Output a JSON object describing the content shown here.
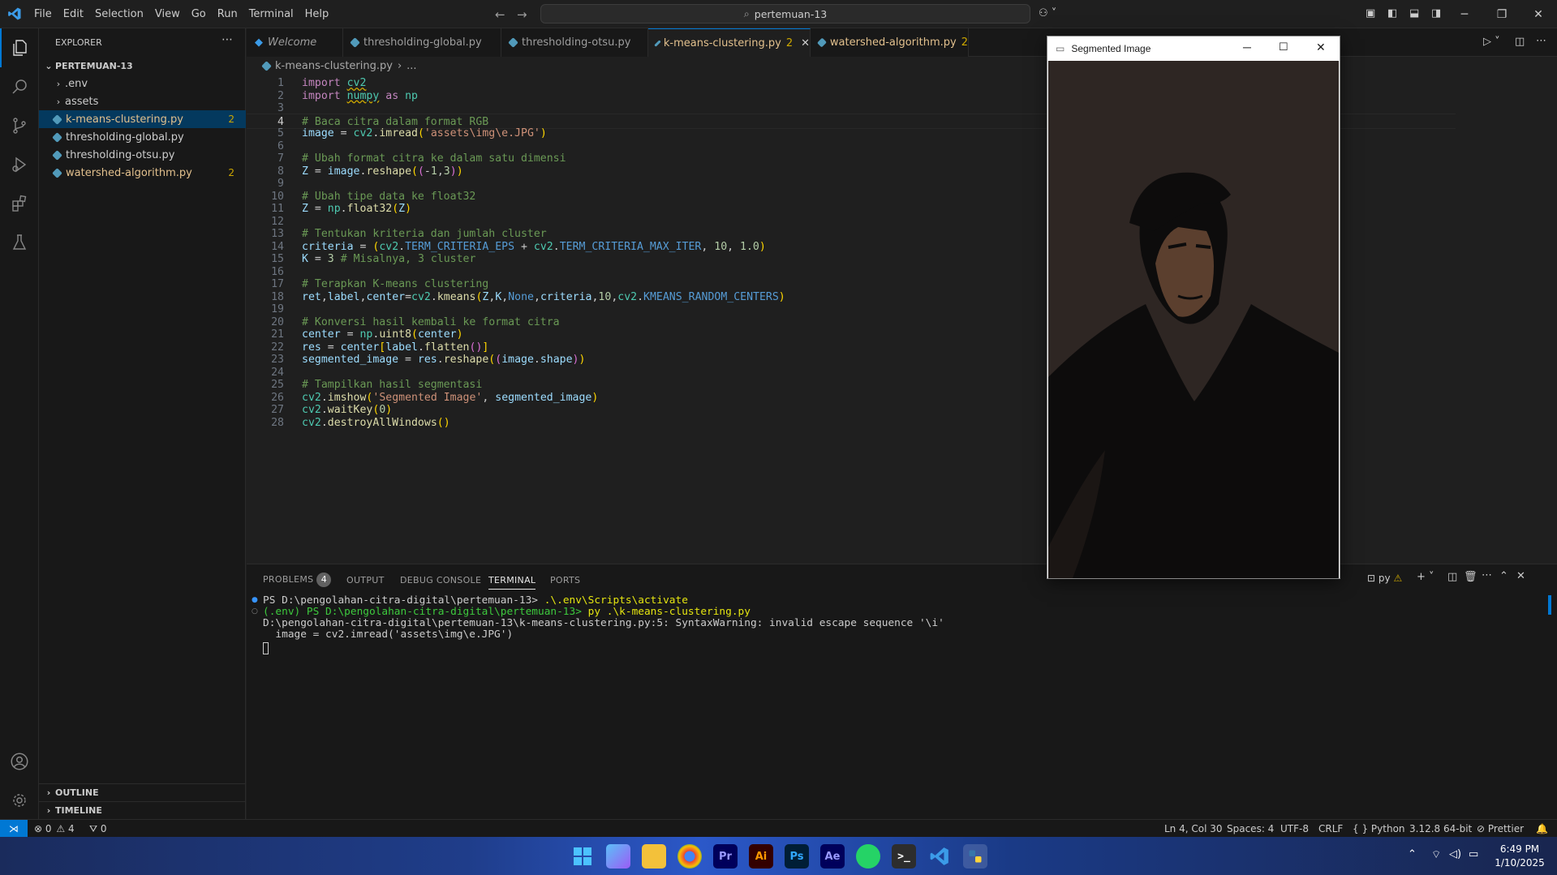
{
  "menu": [
    "File",
    "Edit",
    "Selection",
    "View",
    "Go",
    "Run",
    "Terminal",
    "Help"
  ],
  "search": {
    "text": "pertemuan-13"
  },
  "sidebar": {
    "title": "EXPLORER",
    "folder": "PERTEMUAN-13",
    "items": [
      {
        "label": ".env",
        "type": "folder"
      },
      {
        "label": "assets",
        "type": "folder"
      },
      {
        "label": "k-means-clustering.py",
        "type": "file",
        "badge": "2",
        "selected": true
      },
      {
        "label": "thresholding-global.py",
        "type": "file"
      },
      {
        "label": "thresholding-otsu.py",
        "type": "file"
      },
      {
        "label": "watershed-algorithm.py",
        "type": "file",
        "badge": "2"
      }
    ],
    "outline": "OUTLINE",
    "timeline": "TIMELINE"
  },
  "tabs": [
    {
      "label": "Welcome"
    },
    {
      "label": "thresholding-global.py"
    },
    {
      "label": "thresholding-otsu.py"
    },
    {
      "label": "k-means-clustering.py",
      "badge": "2",
      "active": true
    },
    {
      "label": "watershed-algorithm.py",
      "badge": "2"
    }
  ],
  "breadcrumb": {
    "file": "k-means-clustering.py",
    "rest": "..."
  },
  "code_lines": [
    "import cv2",
    "import numpy as np",
    "",
    "# Baca citra dalam format RGB",
    "image = cv2.imread('assets\\img\\e.JPG')",
    "",
    "# Ubah format citra ke dalam satu dimensi",
    "Z = image.reshape((-1,3))",
    "",
    "# Ubah tipe data ke float32",
    "Z = np.float32(Z)",
    "",
    "# Tentukan kriteria dan jumlah cluster",
    "criteria = (cv2.TERM_CRITERIA_EPS + cv2.TERM_CRITERIA_MAX_ITER, 10, 1.0)",
    "K = 3 # Misalnya, 3 cluster",
    "",
    "# Terapkan K-means clustering",
    "ret,label,center=cv2.kmeans(Z,K,None,criteria,10,cv2.KMEANS_RANDOM_CENTERS)",
    "",
    "# Konversi hasil kembali ke format citra",
    "center = np.uint8(center)",
    "res = center[label.flatten()]",
    "segmented_image = res.reshape((image.shape))",
    "",
    "# Tampilkan hasil segmentasi",
    "cv2.imshow('Segmented Image', segmented_image)",
    "cv2.waitKey(0)",
    "cv2.destroyAllWindows()"
  ],
  "panel": {
    "tabs": [
      "PROBLEMS",
      "OUTPUT",
      "DEBUG CONSOLE",
      "TERMINAL",
      "PORTS"
    ],
    "problems_count": "4",
    "terminal_shell": "py",
    "terminal": {
      "line1_prompt": "PS D:\\pengolahan-citra-digital\\pertemuan-13> ",
      "line1_cmd": ".\\.env\\Scripts\\activate",
      "line2_prompt": "(.env) PS D:\\pengolahan-citra-digital\\pertemuan-13> ",
      "line2_cmd": "py .\\k-means-clustering.py",
      "line3": "D:\\pengolahan-citra-digital\\pertemuan-13\\k-means-clustering.py:5: SyntaxWarning: invalid escape sequence '\\i'",
      "line4": "  image = cv2.imread('assets\\img\\e.JPG')"
    }
  },
  "statusbar": {
    "errors": "0",
    "warnings": "4",
    "ports": "0",
    "position": "Ln 4, Col 30",
    "spaces": "Spaces: 4",
    "encoding": "UTF-8",
    "eol": "CRLF",
    "language": "Python",
    "interpreter": "3.12.8 64-bit",
    "formatter": "Prettier"
  },
  "cv_window": {
    "title": "Segmented Image"
  },
  "taskbar": {
    "apps": [
      "Pr",
      "Ai",
      "Ps",
      "Ae"
    ],
    "time": "6:49 PM",
    "date": "1/10/2025"
  },
  "colors": {
    "accent": "#0078d4",
    "warning": "#cca700",
    "modified_tab": "#e2c08d"
  }
}
